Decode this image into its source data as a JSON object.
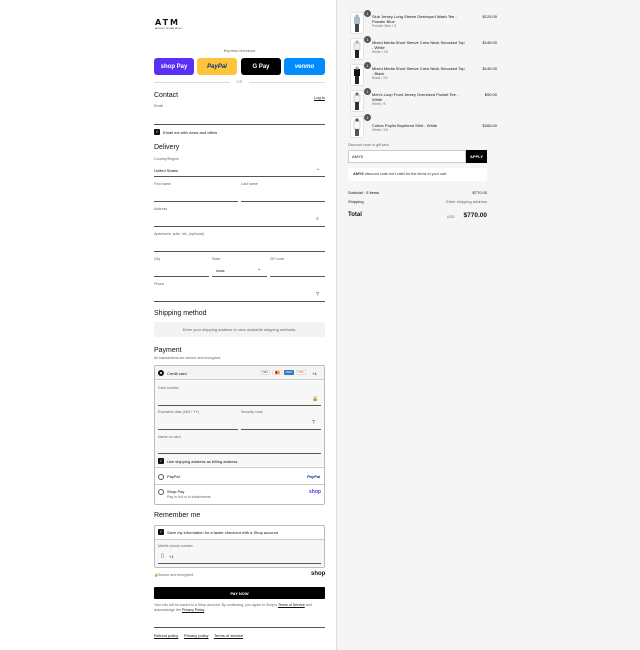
{
  "brand": {
    "name": "ATM",
    "tagline": "ANTHONY THOMAS MELILLO"
  },
  "express": {
    "title": "Express checkout",
    "or": "OR",
    "buttons": [
      {
        "label": "shop Pay",
        "bg": "#5a31f4",
        "fg": "#ffffff"
      },
      {
        "label": "PayPal",
        "bg": "#ffc439",
        "fg": "#003087"
      },
      {
        "label": "G Pay",
        "bg": "#000000",
        "fg": "#ffffff"
      },
      {
        "label": "venmo",
        "bg": "#008cff",
        "fg": "#ffffff"
      }
    ]
  },
  "contact": {
    "title": "Contact",
    "login": "Log in",
    "email_label": "Email",
    "newsletter": "Email me with news and offers"
  },
  "delivery": {
    "title": "Delivery",
    "country_label": "Country/Region",
    "country": "United States",
    "first_name": "First name",
    "last_name": "Last name",
    "address": "Address",
    "apartment": "Apartment, suite, etc. (optional)",
    "city": "City",
    "state_label": "State",
    "state": "Iowa",
    "zip": "ZIP code",
    "phone": "Phone"
  },
  "shipping_method": {
    "title": "Shipping method",
    "note": "Enter your shipping address to view available shipping methods."
  },
  "payment": {
    "title": "Payment",
    "subtitle": "All transactions are secure and encrypted.",
    "credit_card": "Credit card",
    "more_cards": "+4",
    "card_number": "Card number",
    "expiration": "Expiration date (MM / YY)",
    "security": "Security code",
    "name_on_card": "Name on card",
    "billing_same": "Use shipping address as billing address",
    "paypal": "PayPal",
    "paypal_logo": "PayPal",
    "shoppay": "Shop Pay",
    "shoppay_sub": "Pay in full or in installments",
    "shoppay_logo": "shop"
  },
  "remember": {
    "title": "Remember me",
    "save": "Save my information for a faster checkout with a Shop account",
    "mobile_label": "Mobile phone number",
    "phone_prefix": "+1",
    "secure": "Secure and encrypted",
    "shop_logo": "shop"
  },
  "pay_now": "PAY NOW",
  "legal": {
    "text1": "Your info will be saved to a Shop account. By continuing, you agree to Shop's",
    "terms": "Terms of Service",
    "text2": "and acknowledge the",
    "privacy": "Privacy Policy",
    "end": "."
  },
  "footer": {
    "refund": "Refund policy",
    "privacy": "Privacy policy",
    "terms": "Terms of service"
  },
  "cart": {
    "items": [
      {
        "qty": "1",
        "name": "Slub Jersey Long Sleeve Destroyed Wash Tee - Powder Blue",
        "variant": "Powder Blue / S",
        "price": "$125.00"
      },
      {
        "qty": "1",
        "name": "Mixed Media Short Sleeve Crew Neck Smocked Top - White",
        "variant": "White / XS",
        "price": "$145.00"
      },
      {
        "qty": "1",
        "name": "Mixed Media Short Sleeve Crew Neck Smocked Top - Black",
        "variant": "Black / XS",
        "price": "$145.00"
      },
      {
        "qty": "1",
        "name": "Men's Loop Front Jersey Oversized Pocket Tee - White",
        "variant": "White / S",
        "price": "$90.00"
      },
      {
        "qty": "1",
        "name": "Cotton Poplin Boyfriend Shirt - White",
        "variant": "White / XS",
        "price": "$265.00"
      }
    ],
    "discount_label": "Discount code or gift card",
    "discount_value": "AMY5",
    "apply": "APPLY",
    "discount_code": "AMY5",
    "discount_error": "discount code isn't valid for the items in your cart",
    "subtotal_label": "Subtotal · 5 items",
    "subtotal": "$770.00",
    "shipping_label": "Shipping",
    "shipping": "Enter shipping address",
    "total_label": "Total",
    "currency": "USD",
    "total": "$770.00"
  }
}
